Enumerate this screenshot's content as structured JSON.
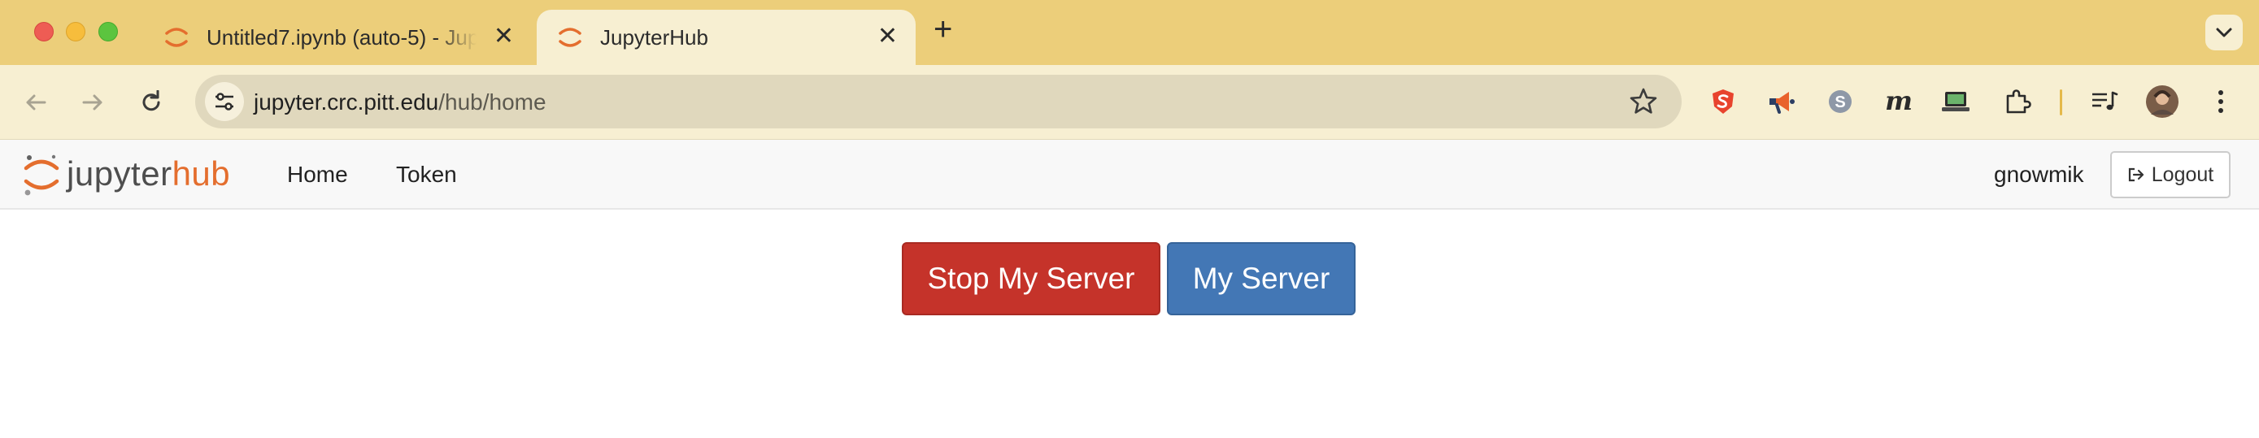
{
  "browser": {
    "tabs": [
      {
        "title": "Untitled7.ipynb (auto-5) - Jupyter",
        "active": false
      },
      {
        "title": "JupyterHub",
        "active": true
      }
    ],
    "new_tab_label": "+",
    "close_glyph": "✕",
    "url_host": "jupyter.crc.pitt.edu",
    "url_path": "/hub/home",
    "colors": {
      "tab_strip": "#ecce7a",
      "toolbar": "#f7efd2",
      "omnibox": "#e0d8bd"
    },
    "extensions": [
      "shield-s-extension-icon",
      "megaphone-extension-icon",
      "skype-extension-icon",
      "m-extension-icon",
      "laptop-extension-icon",
      "puzzle-extensions-icon",
      "media-queue-icon",
      "profile-avatar",
      "more-menu-icon"
    ]
  },
  "hub": {
    "logo": {
      "part1": "jupyter",
      "part2": "hub"
    },
    "nav": {
      "home": "Home",
      "token": "Token"
    },
    "user": "gnowmik",
    "logout_label": "Logout"
  },
  "main": {
    "stop_label": "Stop My Server",
    "my_server_label": "My Server",
    "colors": {
      "stop": "#c5332a",
      "my_server": "#4377b5"
    }
  }
}
